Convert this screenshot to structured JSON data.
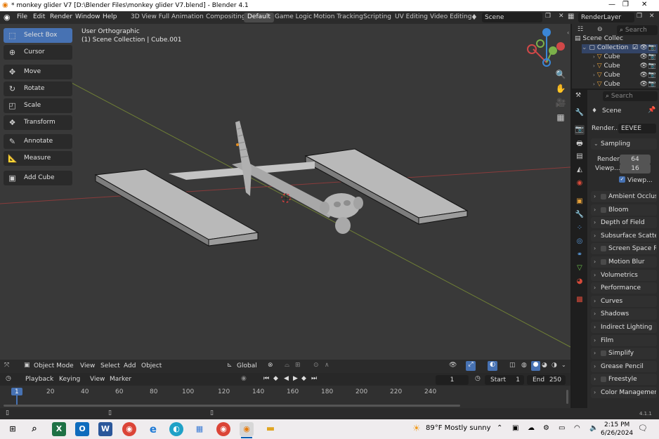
{
  "titlebar": {
    "title": "* monkey glider V7 [D:\\Blender Files\\monkey glider V7.blend] - Blender 4.1"
  },
  "menus": [
    "File",
    "Edit",
    "Render",
    "Window",
    "Help"
  ],
  "workspaces": [
    "3D View Full",
    "Animation",
    "Compositing",
    "Default",
    "Game Logic",
    "Motion Tracking",
    "Scripting",
    "UV Editing",
    "Video Editing"
  ],
  "active_workspace": "Default",
  "scene_field": "Scene",
  "view_layer_field": "RenderLayer",
  "viewport": {
    "view_name": "User Orthographic",
    "collection_info": "(1) Scene Collection | Cube.001"
  },
  "tools": [
    {
      "label": "Select Box",
      "icon": "select-box-icon"
    },
    {
      "label": "Cursor",
      "icon": "cursor-icon"
    },
    {
      "label": "Move",
      "icon": "move-icon"
    },
    {
      "label": "Rotate",
      "icon": "rotate-icon"
    },
    {
      "label": "Scale",
      "icon": "scale-icon"
    },
    {
      "label": "Transform",
      "icon": "transform-icon"
    },
    {
      "label": "Annotate",
      "icon": "annotate-icon"
    },
    {
      "label": "Measure",
      "icon": "measure-icon"
    },
    {
      "label": "Add Cube",
      "icon": "add-cube-icon"
    }
  ],
  "viewport_header": {
    "mode": "Object Mode",
    "menus": [
      "View",
      "Select",
      "Add",
      "Object"
    ],
    "transform_orientation": "Global"
  },
  "timeline": {
    "menus": [
      "Playback",
      "Keying",
      "View",
      "Marker"
    ],
    "current_frame": "1",
    "start_label": "Start",
    "start": "1",
    "end_label": "End",
    "end": "250",
    "ticks": [
      "1",
      "20",
      "40",
      "60",
      "80",
      "100",
      "120",
      "140",
      "160",
      "180",
      "200",
      "220",
      "240"
    ]
  },
  "outliner": {
    "search_placeholder": "Search",
    "scene_collection": "Scene Collec",
    "collection": "Collection",
    "items": [
      "Cube",
      "Cube",
      "Cube",
      "Cube"
    ]
  },
  "properties": {
    "search_placeholder": "Search",
    "scene_label": "Scene",
    "render_engine_label": "Render...",
    "render_engine": "EEVEE",
    "sampling_label": "Sampling",
    "render_samples_label": "Render",
    "render_samples": "64",
    "viewport_samples_label": "Viewp...",
    "viewport_samples": "16",
    "viewport_denoise_label": "Viewp...",
    "panels": [
      {
        "label": "Ambient Occlusion",
        "checkbox": true
      },
      {
        "label": "Bloom",
        "checkbox": true
      },
      {
        "label": "Depth of Field",
        "checkbox": false
      },
      {
        "label": "Subsurface Scattering",
        "checkbox": false
      },
      {
        "label": "Screen Space Reflections",
        "checkbox": true
      },
      {
        "label": "Motion Blur",
        "checkbox": true
      },
      {
        "label": "Volumetrics",
        "checkbox": false
      },
      {
        "label": "Performance",
        "checkbox": false
      },
      {
        "label": "Curves",
        "checkbox": false
      },
      {
        "label": "Shadows",
        "checkbox": false
      },
      {
        "label": "Indirect Lighting",
        "checkbox": false
      },
      {
        "label": "Film",
        "checkbox": false
      },
      {
        "label": "Simplify",
        "checkbox": true
      },
      {
        "label": "Grease Pencil",
        "checkbox": false
      },
      {
        "label": "Freestyle",
        "checkbox": true
      },
      {
        "label": "Color Management",
        "checkbox": false
      }
    ]
  },
  "status": {
    "version": "4.1.1"
  },
  "taskbar": {
    "weather": "89°F  Mostly sunny",
    "time": "2:15 PM",
    "date": "6/26/2024"
  },
  "colors": {
    "accent": "#4772b3",
    "x_axis": "#d04848",
    "y_axis": "#7bb04a",
    "z_axis": "#3b86d6"
  }
}
